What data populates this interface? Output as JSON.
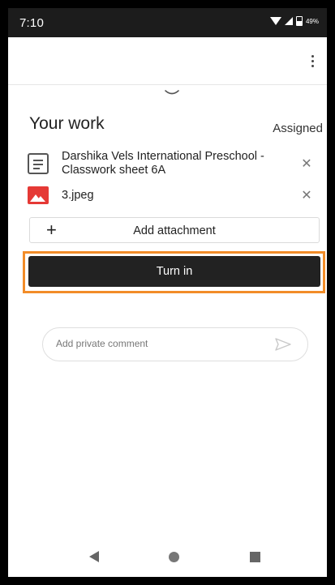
{
  "status_bar": {
    "time": "7:10",
    "battery": "49%"
  },
  "app_bar": {
    "menu_icon": "more-vert-icon"
  },
  "your_work": {
    "title": "Your work",
    "status": "Assigned"
  },
  "attachments": [
    {
      "title": "Darshika Vels International Preschool - Classwork sheet 6A",
      "icon": "doc-icon"
    },
    {
      "title": "3.jpeg",
      "icon": "image-icon"
    }
  ],
  "actions": {
    "add_attachment_label": "Add attachment",
    "turn_in_label": "Turn in"
  },
  "comment": {
    "placeholder": "Add private comment"
  },
  "colors": {
    "highlight": "#f28c28",
    "primary_button": "#222222",
    "image_icon": "#e53935"
  }
}
